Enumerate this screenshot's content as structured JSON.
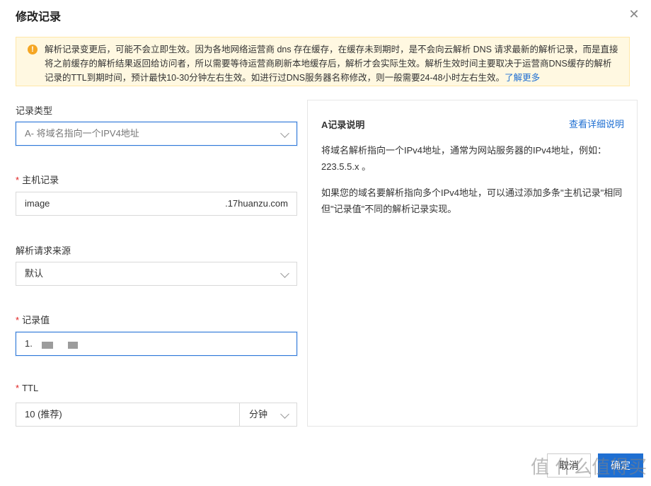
{
  "dialog": {
    "title": "修改记录"
  },
  "notice": {
    "text": "解析记录变更后，可能不会立即生效。因为各地网络运营商 dns 存在缓存，在缓存未到期时，是不会向云解析 DNS 请求最新的解析记录，而是直接将之前缓存的解析结果返回给访问者，所以需要等待运营商刷新本地缓存后，解析才会实际生效。解析生效时间主要取决于运营商DNS缓存的解析记录的TTL到期时间，预计最快10-30分钟左右生效。如进行过DNS服务器名称修改，则一般需要24-48小时左右生效。",
    "link": "了解更多"
  },
  "form": {
    "record_type": {
      "label": "记录类型",
      "value": "A- 将域名指向一个IPV4地址"
    },
    "host": {
      "label": "主机记录",
      "value": "image",
      "suffix": ".17huanzu.com"
    },
    "source": {
      "label": "解析请求来源",
      "value": "默认"
    },
    "record_value": {
      "label": "记录值",
      "value": "1."
    },
    "ttl": {
      "label": "TTL",
      "value": "10 (推荐)",
      "unit": "分钟"
    }
  },
  "info": {
    "title": "A记录说明",
    "link": "查看详细说明",
    "p1": "将域名解析指向一个IPv4地址，通常为网站服务器的IPv4地址，例如：223.5.5.x 。",
    "p2": "如果您的域名要解析指向多个IPv4地址，可以通过添加多条\"主机记录\"相同但\"记录值\"不同的解析记录实现。"
  },
  "buttons": {
    "cancel": "取消",
    "ok": "确定"
  },
  "watermark": "值 什么值得买"
}
